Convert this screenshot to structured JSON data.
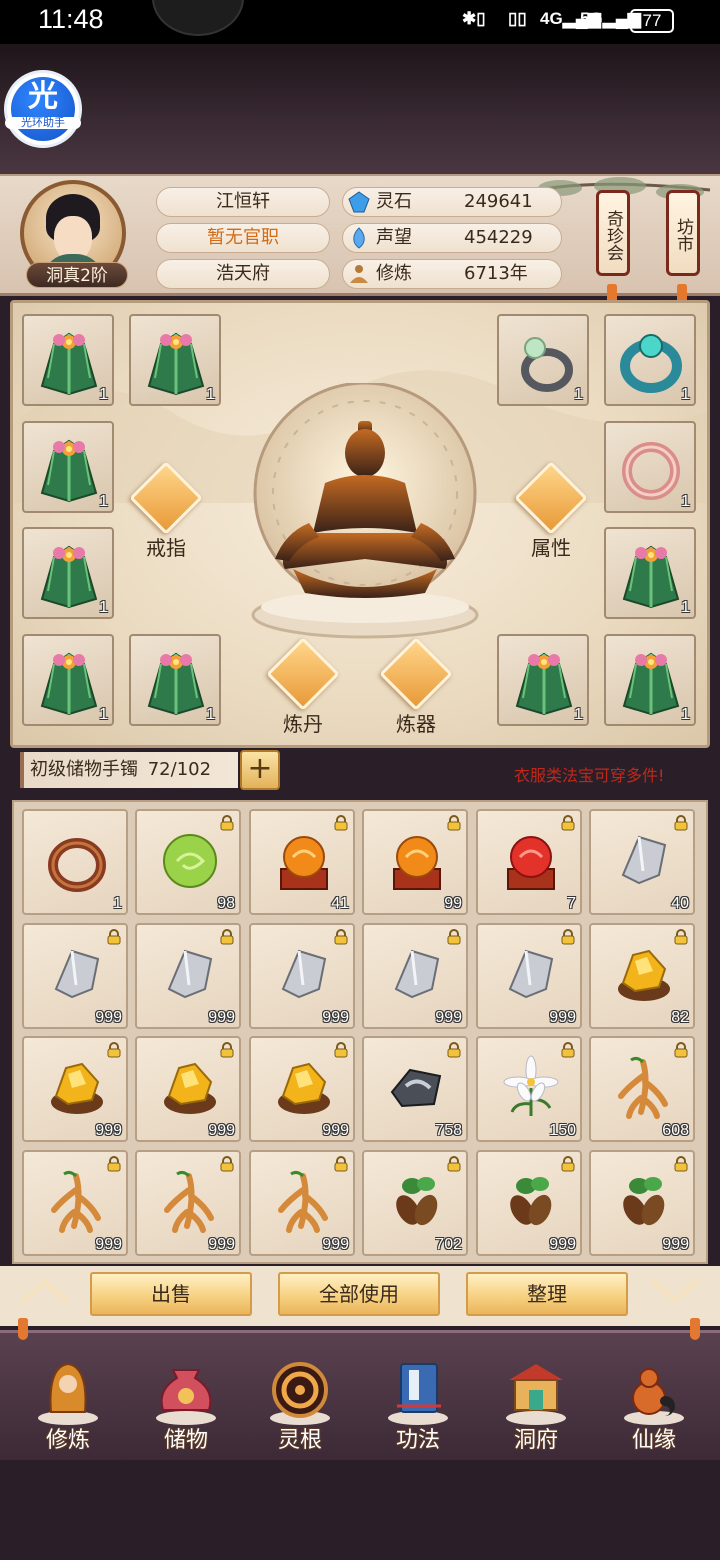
{
  "status_bar": {
    "time": "11:48",
    "signal_4g": "4G",
    "signal_5g": "5G",
    "battery": "77"
  },
  "helper": {
    "big": "光",
    "small": "光环助手"
  },
  "profile": {
    "rank": "洞真2阶",
    "name": "江恒轩",
    "title": "暂无官职",
    "residence": "浩天府",
    "resources": [
      {
        "label": "灵石",
        "value": "249641",
        "icon": "spirit-stone-icon"
      },
      {
        "label": "声望",
        "value": "454229",
        "icon": "prestige-icon"
      },
      {
        "label": "修炼",
        "value": "6713年",
        "icon": "cultivation-icon"
      }
    ],
    "side_buttons": [
      {
        "label": "奇珍会"
      },
      {
        "label": "坊市"
      }
    ]
  },
  "equipment": {
    "ring_label": "戒指",
    "attr_label": "属性",
    "alchemy_label": "炼丹",
    "forge_label": "炼器",
    "left_slots": [
      {
        "count": "1"
      },
      {
        "count": "1"
      },
      {
        "count": "1"
      },
      {
        "count": "1"
      },
      {
        "count": "1"
      },
      {
        "count": "1"
      }
    ],
    "right_slots": [
      {
        "count": "1"
      },
      {
        "count": "1"
      },
      {
        "count": "1"
      },
      {
        "count": "1"
      },
      {
        "count": "1"
      },
      {
        "count": "1"
      }
    ]
  },
  "storage": {
    "name": "初级储物手镯",
    "capacity": "72/102",
    "add": "+",
    "notice": "衣服类法宝可穿多件!"
  },
  "inventory": [
    {
      "item": "ring",
      "count": "1",
      "locked": false
    },
    {
      "item": "green-orb",
      "count": "98",
      "locked": true
    },
    {
      "item": "orange-orb-stand",
      "count": "41",
      "locked": true
    },
    {
      "item": "orange-orb-stand",
      "count": "99",
      "locked": true
    },
    {
      "item": "red-orb-stand",
      "count": "7",
      "locked": true
    },
    {
      "item": "silver-ore",
      "count": "40",
      "locked": true
    },
    {
      "item": "silver-ore",
      "count": "999",
      "locked": true
    },
    {
      "item": "silver-ore",
      "count": "999",
      "locked": true
    },
    {
      "item": "silver-ore",
      "count": "999",
      "locked": true
    },
    {
      "item": "silver-ore",
      "count": "999",
      "locked": true
    },
    {
      "item": "silver-ore",
      "count": "999",
      "locked": true
    },
    {
      "item": "gold-ore",
      "count": "82",
      "locked": true
    },
    {
      "item": "gold-ore",
      "count": "999",
      "locked": true
    },
    {
      "item": "gold-ore",
      "count": "999",
      "locked": true
    },
    {
      "item": "gold-ore",
      "count": "999",
      "locked": true
    },
    {
      "item": "dark-ore",
      "count": "758",
      "locked": true
    },
    {
      "item": "white-flower",
      "count": "150",
      "locked": true
    },
    {
      "item": "ginseng",
      "count": "608",
      "locked": true
    },
    {
      "item": "ginseng",
      "count": "999",
      "locked": true
    },
    {
      "item": "ginseng",
      "count": "999",
      "locked": true
    },
    {
      "item": "ginseng",
      "count": "999",
      "locked": true
    },
    {
      "item": "herb-root",
      "count": "702",
      "locked": true
    },
    {
      "item": "herb-root",
      "count": "999",
      "locked": true
    },
    {
      "item": "herb-root",
      "count": "999",
      "locked": true
    }
  ],
  "actions": {
    "sell": "出售",
    "use_all": "全部使用",
    "sort": "整理"
  },
  "nav": [
    {
      "label": "修炼",
      "icon": "cultivate-icon"
    },
    {
      "label": "储物",
      "icon": "storage-bag-icon"
    },
    {
      "label": "灵根",
      "icon": "spirit-root-icon"
    },
    {
      "label": "功法",
      "icon": "technique-book-icon"
    },
    {
      "label": "洞府",
      "icon": "cave-dwelling-icon"
    },
    {
      "label": "仙缘",
      "icon": "immortal-fate-icon"
    }
  ],
  "colors": {
    "accent_orange": "#d26a16",
    "warning_red": "#c0281a",
    "panel_beige": "#eadac0"
  }
}
